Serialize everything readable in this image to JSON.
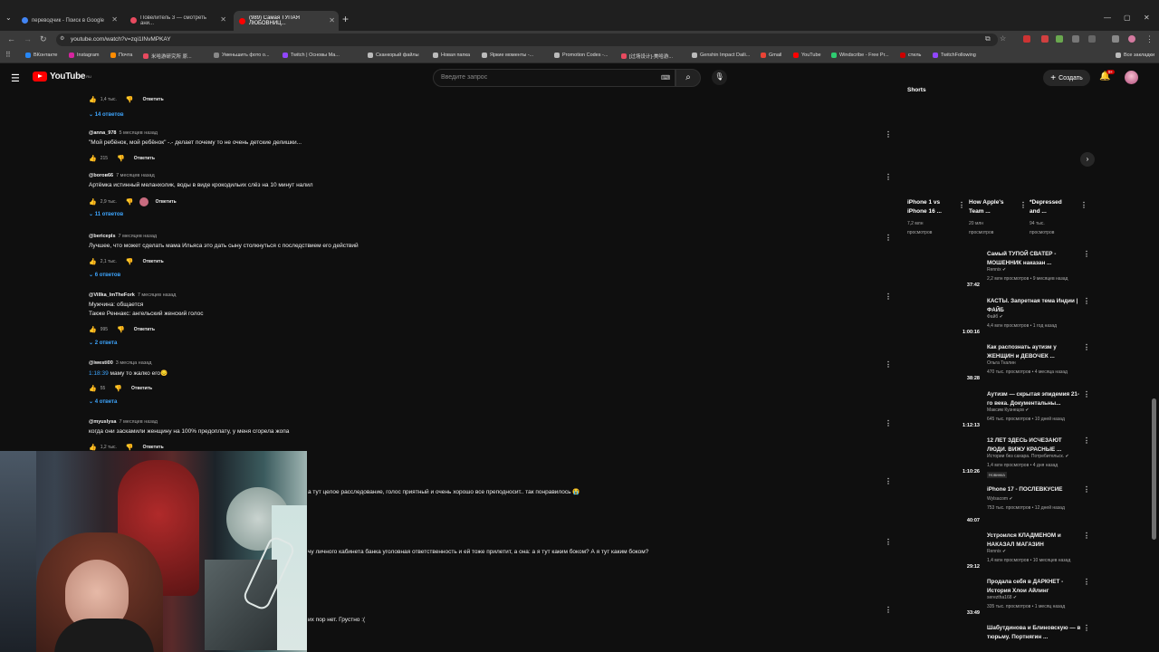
{
  "browser": {
    "tabs": [
      {
        "title": "переводчик - Поиск в Google",
        "color": "#4285f4"
      },
      {
        "title": "Повелитель 3 — смотреть ани...",
        "color": "#e84a5f"
      },
      {
        "title": "(989) Самая ТУПАЯ ЛЮБОВНИЦ...",
        "color": "#ff0000"
      }
    ],
    "new_tab": "+",
    "url": "youtube.com/watch?v=zqi1INvMPKAY",
    "bookmarks": [
      {
        "label": "ВКонтакте",
        "color": "#2787f5"
      },
      {
        "label": "Instagram",
        "color": "#d6249f"
      },
      {
        "label": "Почта",
        "color": "#ff8c00"
      },
      {
        "label": "米哈游研究所 原...",
        "color": "#e84a5f"
      },
      {
        "label": "Уменьшить фото о...",
        "color": "#888888"
      },
      {
        "label": "Twitch | Основы Ма...",
        "color": "#9146ff"
      },
      {
        "label": "Сканкорый файлы",
        "color": "#bbbbbb"
      },
      {
        "label": "Новая папка",
        "color": "#bbbbbb"
      },
      {
        "label": "Яркие моменты -...",
        "color": "#bbbbbb"
      },
      {
        "label": "Promotion Codes -...",
        "color": "#bbbbbb"
      },
      {
        "label": "[过场设计]-美哈游...",
        "color": "#e84a5f"
      },
      {
        "label": "Genshin Impact Daili...",
        "color": "#bbbbbb"
      },
      {
        "label": "Gmail",
        "color": "#ea4335"
      },
      {
        "label": "YouTube",
        "color": "#ff0000"
      },
      {
        "label": "Windscribe - Free Pr...",
        "color": "#2ecc71"
      },
      {
        "label": "стиль",
        "color": "#cc0000"
      },
      {
        "label": "TwitchFollowing",
        "color": "#9146ff"
      }
    ],
    "all_bookmarks": "Все закладки"
  },
  "youtube": {
    "logo_text": "YouTube",
    "logo_region": "RU",
    "search_placeholder": "Введите запрос",
    "create_label": "Создать",
    "notif_count": "9+"
  },
  "comments": {
    "top_likes": "1,4 тыс.",
    "top_reply": "Ответить",
    "top_replies_toggle": "14 ответов",
    "items": [
      {
        "author": "@anna_978",
        "time": "5 месяцев назад",
        "text": "\"Мой ребёнок, мой ребёнок\" -.- делает почему то не очень детские делишки...",
        "likes": "215",
        "reply": "Ответить",
        "replies": ""
      },
      {
        "author": "@boroв66",
        "time": "7 месяцев назад",
        "text": "Артёмка истинный меланхолик, воды в виде крокодильих слёз на 10 минут налил",
        "likes": "2,9 тыс.",
        "reply": "Ответить",
        "replies": "11 ответов"
      },
      {
        "author": "@bericepls",
        "time": "7 месяцев назад",
        "text": "Лучшее, что может сделать мама Ильяса это дать сыну столкнуться с последствием его действий",
        "likes": "2,1 тыс.",
        "reply": "Ответить",
        "replies": "6 ответов"
      },
      {
        "author": "@Villka_ImTheFork",
        "time": "7 месяцев назад",
        "text": "Мужчина: общается",
        "text2": "Также Реннакс: ангельский женский голос",
        "likes": "995",
        "reply": "Ответить",
        "replies": "2 ответа"
      },
      {
        "author": "@iwesti00",
        "time": "3 месяца назад",
        "ts": "1:18:39",
        "text": " маму то жалко его😔",
        "likes": "55",
        "reply": "Ответить",
        "replies": "4 ответа"
      },
      {
        "author": "@myuslysa",
        "time": "7 месяцев назад",
        "text": "когда они заскамили женщину на 100% предоплату, у меня сгорела жопа",
        "likes": "1,2 тыс.",
        "reply": "Ответить",
        "replies": ""
      }
    ],
    "partial": [
      "а тут целое расследование, голос приятный и очень хорошо все преподносит.. так понравилось 😭",
      "чу личного кабинета банка уголовная ответственность и ей тоже прилетит, а она: а я тут каким боком? А я тут каким боком?",
      "их пор нет. Грустно :("
    ]
  },
  "sidebar": {
    "shorts_header": "Shorts",
    "shorts": [
      {
        "title1": "iPhone 1 vs",
        "title2": "iPhone 16 ...",
        "views1": "7,2 млн",
        "views2": "просмотров"
      },
      {
        "title1": "How Apple's",
        "title2": "Team ...",
        "views1": "20 млн",
        "views2": "просмотров"
      },
      {
        "title1": "*Depressed",
        "title2": "and ...",
        "views1": "94 тыс.",
        "views2": "просмотров"
      }
    ],
    "videos": [
      {
        "title": "Самый ТУПОЙ СВАТЕР - МОШЕННИК наказан ...",
        "channel": "Rennix ✔",
        "meta": "2,2 млн просмотров • 9 месяцев назад",
        "duration": "37:42",
        "badge": ""
      },
      {
        "title": "КАСТЫ. Запретная тема Индии | ФАЙБ",
        "channel": "Файб ✔",
        "meta": "4,4 млн просмотров • 1 год назад",
        "duration": "1:00:16",
        "badge": ""
      },
      {
        "title": "Как распознать аутизм у ЖЕНЩИН и ДЕВОЧЕК ...",
        "channel": "Ольга Ткалин",
        "meta": "470 тыс. просмотров • 4 месяца назад",
        "duration": "38:28",
        "badge": ""
      },
      {
        "title": "Аутизм — скрытая эпидемия 21-го века. Документальны...",
        "channel": "Максим Кузнецов ✔",
        "meta": "645 тыс. просмотров • 10 дней назад",
        "duration": "1:12:13",
        "badge": ""
      },
      {
        "title": "12 ЛЕТ ЗДЕСЬ ИСЧЕЗАЮТ ЛЮДИ. ВИЖУ КРАСНЫЕ ...",
        "channel": "Истории без сахара. Потребительск. ✔",
        "meta": "1,4 млн просмотров • 4 дня назад",
        "duration": "1:10:26",
        "badge": "Новинка"
      },
      {
        "title": "iPhone 17 - ПОСЛЕВКУСИЕ",
        "channel": "Wylsacom ✔",
        "meta": "753 тыс. просмотров • 12 дней назад",
        "duration": "40:07",
        "badge": ""
      },
      {
        "title": "Устроился КЛАДМЕНОМ и НАКАЗАЛ МАГАЗИН",
        "channel": "Rennix ✔",
        "meta": "1,4 млн просмотров • 10 месяцев назад",
        "duration": "29:12",
        "badge": ""
      },
      {
        "title": "Продала себя в ДАРКНЕТ - История Хлои Айлинг",
        "channel": "sereztha168 ✔",
        "meta": "335 тыс. просмотров • 1 месяц назад",
        "duration": "33:49",
        "badge": ""
      },
      {
        "title": "Шабутдинова и Блиновскую — в тюрьму. Портнягин ...",
        "channel": "",
        "meta": "",
        "duration": "",
        "badge": ""
      }
    ]
  },
  "colors": {
    "accent": "#ff0000",
    "link": "#3ea6ff",
    "bg": "#0f0f0f"
  }
}
